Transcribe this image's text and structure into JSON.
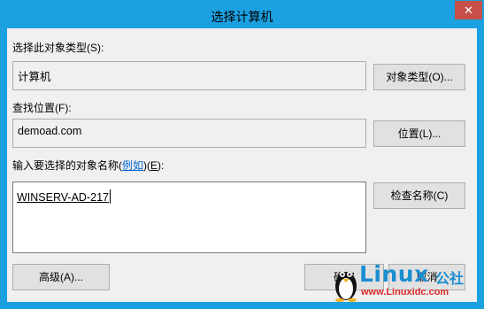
{
  "window": {
    "title": "选择计算机",
    "close_glyph": "✕"
  },
  "object_type": {
    "label": "选择此对象类型(S):",
    "value": "计算机",
    "button": "对象类型(O)..."
  },
  "location": {
    "label": "查找位置(F):",
    "value": "demoad.com",
    "button": "位置(L)..."
  },
  "names": {
    "label_prefix": "输入要选择的对象名称(",
    "label_link": "例如",
    "label_suffix_1": ")(",
    "label_suffix_accel": "E",
    "label_suffix_2": "):",
    "value": "WINSERV-AD-217",
    "button": "检查名称(C)"
  },
  "footer": {
    "advanced_button": "高级(A)...",
    "ok_button": "确定",
    "cancel_button": "取消"
  },
  "watermark": {
    "logo_text": "Linux",
    "logo_suffix": "公社",
    "url": "www.Linuxidc.com"
  },
  "colors": {
    "titlebar": "#1ba1e2",
    "close": "#c7504a",
    "link": "#0066cc"
  }
}
